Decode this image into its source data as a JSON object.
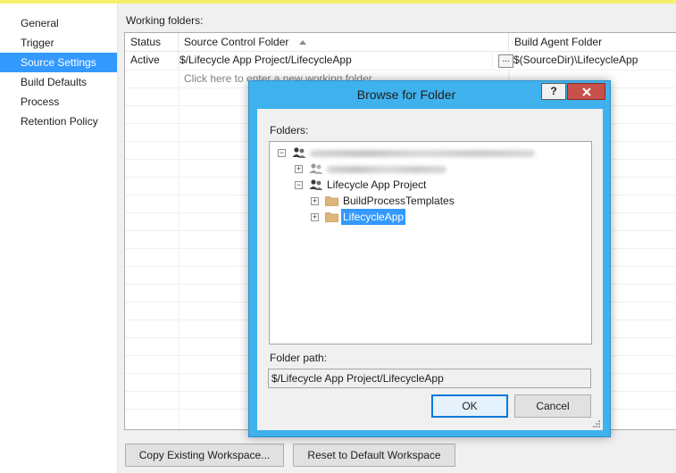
{
  "sidebar": {
    "items": [
      {
        "label": "General"
      },
      {
        "label": "Trigger"
      },
      {
        "label": "Source Settings"
      },
      {
        "label": "Build Defaults"
      },
      {
        "label": "Process"
      },
      {
        "label": "Retention Policy"
      }
    ],
    "selected": "Source Settings"
  },
  "working_folders": {
    "label": "Working folders:",
    "columns": [
      "Status",
      "Source Control Folder",
      "Build Agent Folder"
    ],
    "rows": [
      {
        "status": "Active",
        "source_folder": "$/Lifecycle App Project/LifecycleApp",
        "ellipsis": "...",
        "agent_folder": "$(SourceDir)\\LifecycleApp"
      }
    ],
    "new_row_placeholder": "Click here to enter a new working folder"
  },
  "buttons": {
    "copy_workspace": "Copy Existing Workspace...",
    "reset_workspace": "Reset to Default Workspace"
  },
  "dialog": {
    "title": "Browse for Folder",
    "help": "?",
    "folders_label": "Folders:",
    "tree": {
      "project": "Lifecycle App Project",
      "children": [
        "BuildProcessTemplates",
        "LifecycleApp"
      ],
      "selected": "LifecycleApp"
    },
    "folder_path_label": "Folder path:",
    "folder_path_value": "$/Lifecycle App Project/LifecycleApp",
    "ok": "OK",
    "cancel": "Cancel"
  },
  "colors": {
    "selection": "#3399ff",
    "dialog_frame": "#3fb2ee",
    "close_button": "#c7504b",
    "folder_icon": "#dcb67a"
  },
  "icons": {
    "expand": "plus-box-icon",
    "collapse": "minus-box-icon",
    "server": "users-icon",
    "folder": "folder-icon"
  }
}
